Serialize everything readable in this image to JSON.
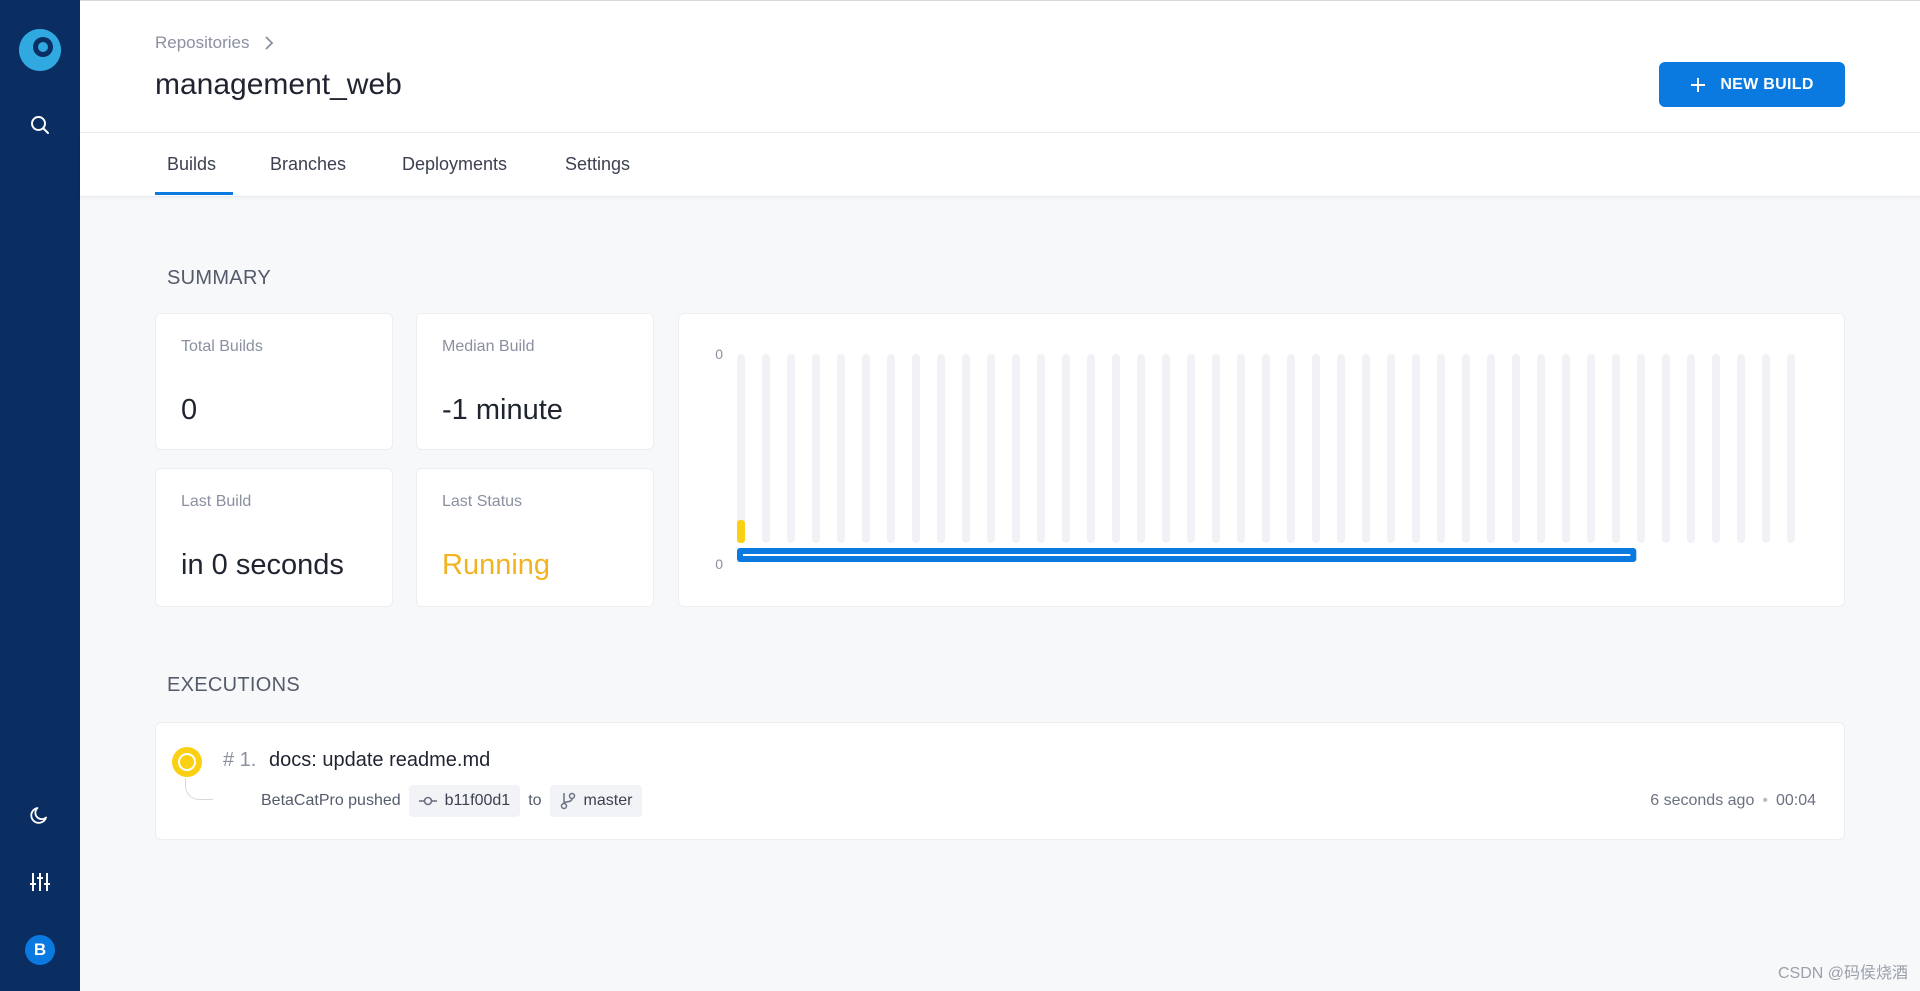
{
  "sidebar": {
    "logo_alt": "Drone",
    "items": [
      {
        "icon": "search-icon"
      },
      {
        "icon": "moon-icon"
      },
      {
        "icon": "sliders-icon"
      }
    ],
    "avatar_initial": "B"
  },
  "breadcrumb": {
    "root": "Repositories",
    "separator_icon": "chevron-right-icon"
  },
  "page_title": "management_web",
  "new_build_label": "NEW BUILD",
  "tabs": [
    {
      "label": "Builds",
      "active": true
    },
    {
      "label": "Branches",
      "active": false
    },
    {
      "label": "Deployments",
      "active": false
    },
    {
      "label": "Settings",
      "active": false
    }
  ],
  "summary": {
    "title": "SUMMARY",
    "total_builds": {
      "label": "Total Builds",
      "value": "0"
    },
    "median_build": {
      "label": "Median Build",
      "value": "-1 minute"
    },
    "last_build": {
      "label": "Last Build",
      "value": "in 0 seconds"
    },
    "last_status": {
      "label": "Last Status",
      "value": "Running",
      "color": "#f2b321"
    }
  },
  "chart_data": {
    "type": "bar",
    "bar_count": 43,
    "values": [
      1
    ],
    "y_tick_labels": [
      "0",
      "0"
    ],
    "running_color": "#fbd012",
    "progress_color": "#0a79e0",
    "track_color": "#f1f2f6",
    "progress_fraction": 0.85
  },
  "executions": {
    "title": "EXECUTIONS",
    "items": [
      {
        "number": "# 1.",
        "message": "docs: update readme.md",
        "author_action": "BetaCatPro pushed",
        "commit": "b11f00d1",
        "to": "to",
        "branch": "master",
        "time_ago": "6 seconds ago",
        "duration": "00:04",
        "status_color": "#fbd012"
      }
    ]
  },
  "watermark": "CSDN @码侯烧酒"
}
